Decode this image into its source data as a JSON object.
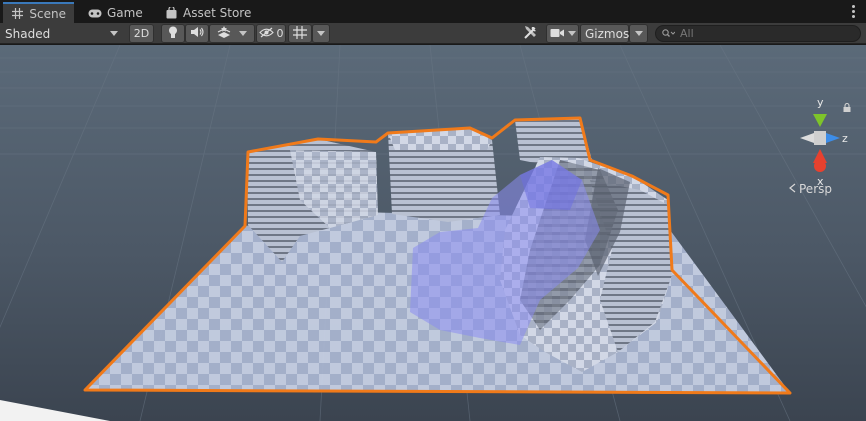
{
  "tabs": [
    {
      "label": "Scene",
      "icon": "grid-icon",
      "active": true
    },
    {
      "label": "Game",
      "icon": "gamepad-icon",
      "active": false
    },
    {
      "label": "Asset Store",
      "icon": "bag-icon",
      "active": false
    }
  ],
  "toolbar": {
    "draw_mode": "Shaded",
    "mode_2d": "2D",
    "hidden_count": "0",
    "gizmos_label": "Gizmos"
  },
  "search": {
    "placeholder": "All"
  },
  "orientation": {
    "y_label": "y",
    "z_label": "z",
    "x_label": "x",
    "projection": "Persp"
  },
  "colors": {
    "accent": "#3a79bb",
    "selection_outline": "#f07a1a",
    "axis_x": "#e8412e",
    "axis_y": "#7ec42a",
    "axis_z": "#3d8de8",
    "navmesh": "#8a8cf0"
  }
}
